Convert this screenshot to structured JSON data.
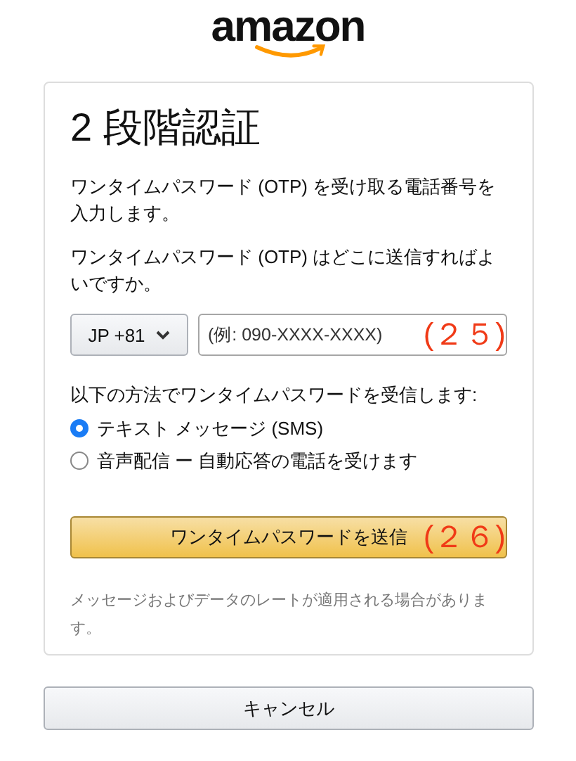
{
  "logo": "amazon",
  "title": "2 段階認証",
  "intro": "ワンタイムパスワード (OTP) を受け取る電話番号を入力します。",
  "question": "ワンタイムパスワード (OTP) はどこに送信すればよいですか。",
  "country_select": {
    "value": "JP +81"
  },
  "phone_field": {
    "placeholder": "(例: 090-XXXX-XXXX)",
    "annotation": "(２５)"
  },
  "method_label": "以下の方法でワンタイムパスワードを受信します:",
  "methods": [
    {
      "label": "テキスト メッセージ (SMS)",
      "selected": true
    },
    {
      "label": "音声配信 ー 自動応答の電話を受けます",
      "selected": false
    }
  ],
  "send_button": {
    "label": "ワンタイムパスワードを送信",
    "annotation": "(２６)"
  },
  "note": "メッセージおよびデータのレートが適用される場合があります。",
  "cancel_button": "キャンセル"
}
